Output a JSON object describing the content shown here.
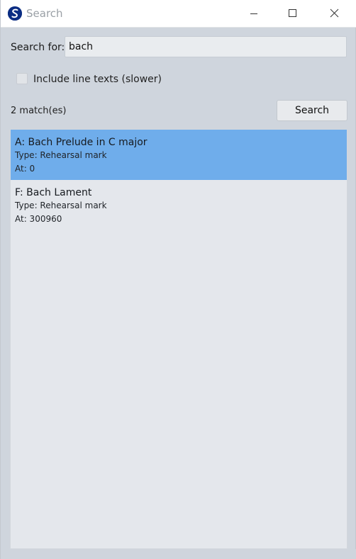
{
  "window": {
    "title": "Search"
  },
  "search": {
    "label": "Search for:",
    "value": "bach",
    "placeholder": ""
  },
  "options": {
    "include_line_texts_label": "Include line texts (slower)",
    "include_line_texts_checked": false
  },
  "status": {
    "match_count": "2 match(es)"
  },
  "actions": {
    "search_label": "Search"
  },
  "results": [
    {
      "title": "A: Bach Prelude in C major",
      "type": "Type: Rehearsal mark",
      "at": "At: 0",
      "selected": true
    },
    {
      "title": "F: Bach Lament",
      "type": "Type: Rehearsal mark",
      "at": "At: 300960",
      "selected": false
    }
  ],
  "colors": {
    "selection": "#6fadeb",
    "app_icon": "#0b2d83"
  },
  "icons": {
    "app": "app-logo-icon",
    "minimize": "minimize-icon",
    "maximize": "maximize-icon",
    "close": "close-icon"
  }
}
